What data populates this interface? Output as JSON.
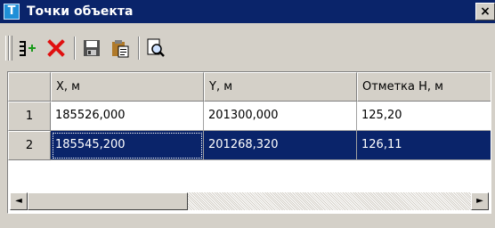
{
  "window": {
    "icon_letter": "T",
    "title": "Точки объекта",
    "close_label": "×"
  },
  "toolbar": {
    "buttons": [
      {
        "name": "add-point",
        "icon": "add-row-icon"
      },
      {
        "name": "delete-point",
        "icon": "delete-x-icon"
      },
      {
        "name": "save-points",
        "icon": "save-icon"
      },
      {
        "name": "paste-points",
        "icon": "paste-icon"
      },
      {
        "name": "preview-points",
        "icon": "print-preview-icon"
      }
    ]
  },
  "table": {
    "columns": [
      "X, м",
      "Y, м",
      "Отметка H, м"
    ],
    "rows": [
      {
        "num": "1",
        "cells": [
          "185526,000",
          "201300,000",
          "125,20"
        ],
        "selected": false
      },
      {
        "num": "2",
        "cells": [
          "185545,200",
          "201268,320",
          "126,11"
        ],
        "selected": true
      }
    ]
  },
  "scrollbar": {
    "left_arrow": "◄",
    "right_arrow": "►"
  },
  "colors": {
    "titlebar": "#0a246a",
    "selection": "#0a246a",
    "face": "#d4d0c8"
  }
}
